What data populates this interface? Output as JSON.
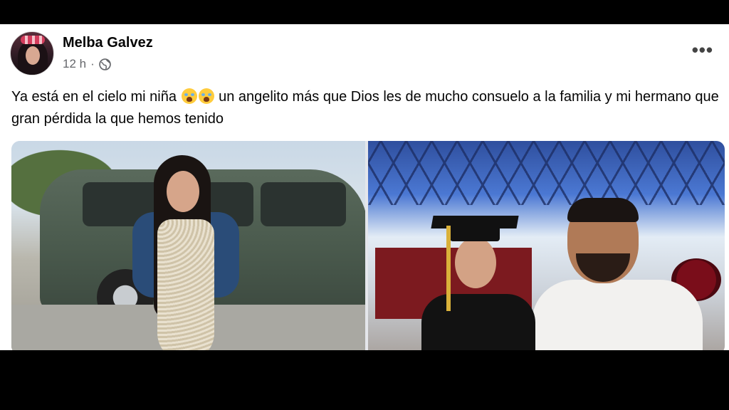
{
  "post": {
    "author": "Melba Galvez",
    "time": "12 h",
    "separator": "·",
    "visibility_icon": "globe-icon",
    "more_icon": "more-options-icon",
    "more_label": "•••",
    "text_part1": "Ya está en el cielo mi niña",
    "emoji": "crying-face-emoji",
    "text_part2": "un angelito más que Dios les de mucho consuelo a la familia y mi hermano que gran pérdida la que hemos tenido"
  },
  "photos": [
    {
      "name": "photo-girl-with-van"
    },
    {
      "name": "photo-graduation"
    }
  ]
}
